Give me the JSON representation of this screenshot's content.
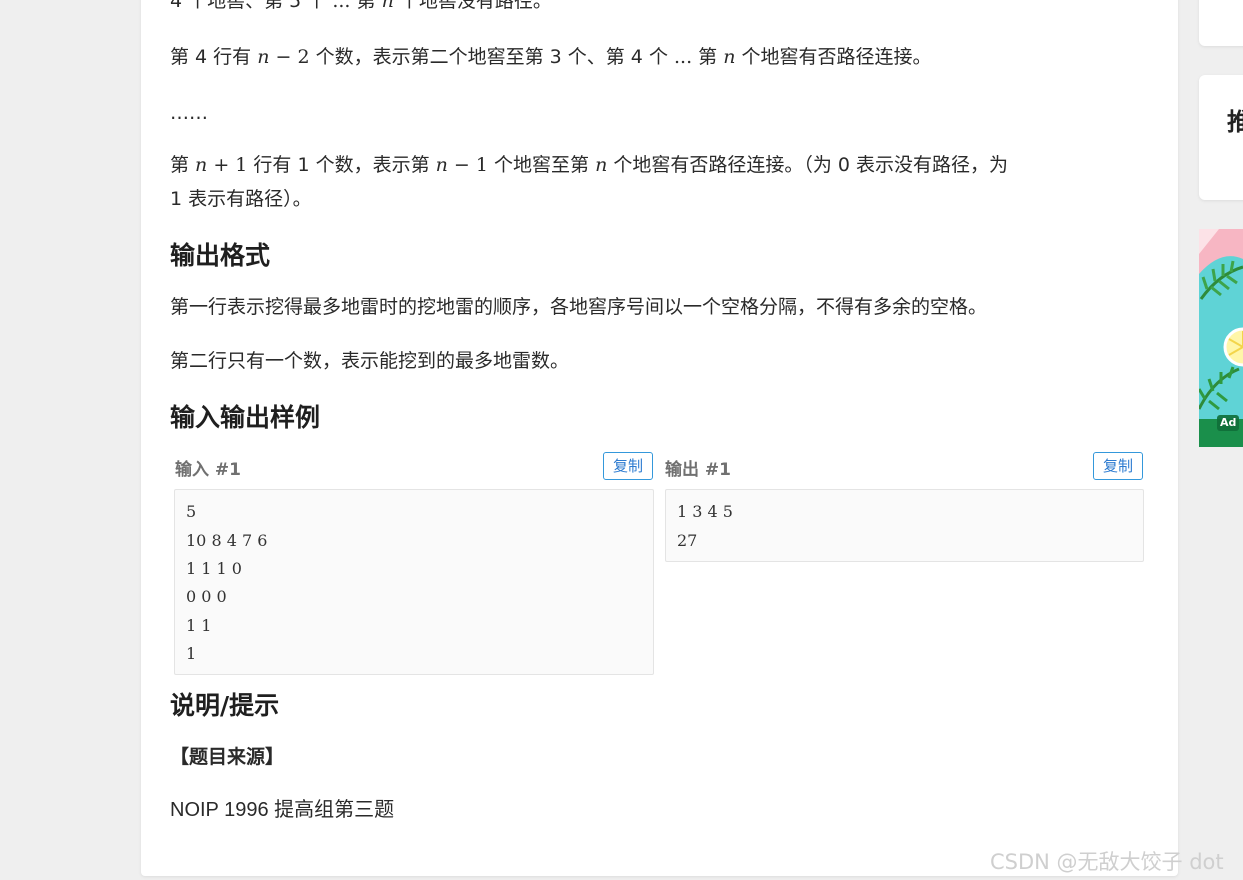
{
  "problem": {
    "text_top_partial": {
      "a": "4 个地窖、第 5 个 ",
      "b": "...",
      "c": " 第 ",
      "n": "n",
      "d": " 个地窖没有路径。"
    },
    "line4": {
      "a": "第 4 行有 ",
      "n": "n",
      "b": " − 2",
      "c": " 个数，表示第二个地窖至第 3 个、第 4 个 ",
      "dots": "...",
      "d": " 第 ",
      "n2": "n",
      "e": " 个地窖有否路径连接。"
    },
    "ellipsis": "……",
    "line_last": {
      "a": "第 ",
      "n": "n",
      "b": " + 1",
      "c": " 行有 1 个数，表示第 ",
      "n2": "n",
      "d": " − 1",
      "e": " 个地窖至第 ",
      "n3": "n",
      "f": " 个地窖有否路径连接。（为 0 表示没有路径，为"
    },
    "line_last2": "1 表示有路径）。",
    "output_format_heading": "输出格式",
    "output_line1": "第一行表示挖得最多地雷时的挖地雷的顺序，各地窖序号间以一个空格分隔，不得有多余的空格。",
    "output_line2": "第二行只有一个数，表示能挖到的最多地雷数。",
    "samples_heading": "输入输出样例",
    "hint_heading": "说明/提示",
    "source_heading": "【题目来源】",
    "source_text": "NOIP 1996 提高组第三题"
  },
  "samples": {
    "input_label": "输入 #1",
    "output_label": "输出 #1",
    "copy_label": "复制",
    "input_lines": [
      "5",
      "10 8 4 7 6",
      "1 1 1 0",
      "0 0 0",
      "1 1",
      "1"
    ],
    "output_lines": [
      "1 3 4 5",
      "27"
    ]
  },
  "sidebar": {
    "heading_partial": "推",
    "ad_badge": "Ad"
  },
  "watermark": "CSDN @无敌大饺子 dot",
  "colors": {
    "accent": "#3498db",
    "page_bg": "#efefef",
    "code_bg": "#fafafa"
  }
}
